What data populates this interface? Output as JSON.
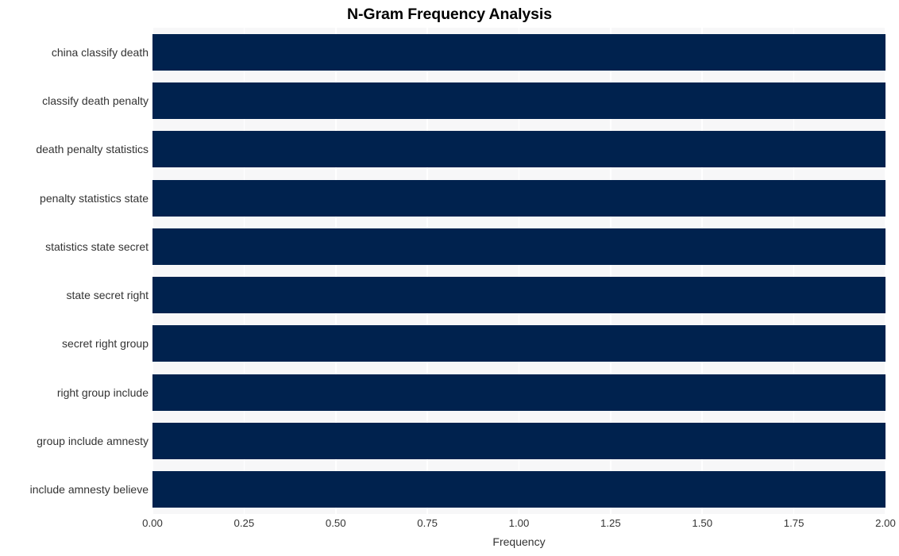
{
  "chart": {
    "title": "N-Gram Frequency Analysis",
    "xlabel": "Frequency",
    "ylabel": ""
  },
  "chart_data": {
    "type": "bar",
    "orientation": "horizontal",
    "title": "N-Gram Frequency Analysis",
    "xlabel": "Frequency",
    "ylabel": "",
    "categories": [
      "china classify death",
      "classify death penalty",
      "death penalty statistics",
      "penalty statistics state",
      "statistics state secret",
      "state secret right",
      "secret right group",
      "right group include",
      "group include amnesty",
      "include amnesty believe"
    ],
    "values": [
      2,
      2,
      2,
      2,
      2,
      2,
      2,
      2,
      2,
      2
    ],
    "xlim": [
      0,
      2
    ],
    "xticks": [
      0,
      0.25,
      0.5,
      0.75,
      1,
      1.25,
      1.5,
      1.75,
      2
    ],
    "xticklabels": [
      "0.00",
      "0.25",
      "0.50",
      "0.75",
      "1.00",
      "1.25",
      "1.50",
      "1.75",
      "2.00"
    ],
    "grid": true,
    "grid_axis": "x",
    "legend": false,
    "bar_color": "#00224e",
    "plot_background": "#f7f7f8",
    "gridline_color": "#ffffff",
    "figure_background": "#ffffff"
  }
}
